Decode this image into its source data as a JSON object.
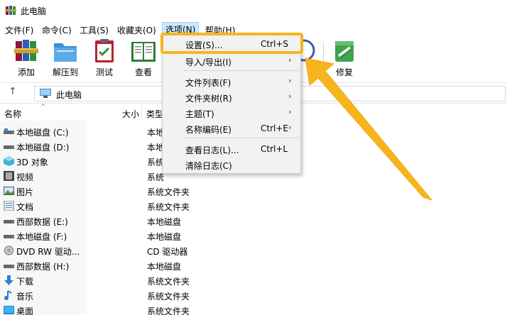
{
  "window": {
    "title": "此电脑"
  },
  "menubar": {
    "items": [
      {
        "label": "文件(F)"
      },
      {
        "label": "命令(C)"
      },
      {
        "label": "工具(S)"
      },
      {
        "label": "收藏夹(O)"
      },
      {
        "label": "选项(N)",
        "active": true
      },
      {
        "label": "帮助(H)"
      }
    ]
  },
  "toolbar": {
    "buttons": [
      {
        "label": "添加",
        "icon": "archive-books-icon"
      },
      {
        "label": "解压到",
        "icon": "folder-extract-icon"
      },
      {
        "label": "测试",
        "icon": "clipboard-check-icon"
      },
      {
        "label": "查看",
        "icon": "open-book-icon"
      },
      {
        "label": "息",
        "icon": "info-icon"
      },
      {
        "label": "修复",
        "icon": "first-aid-box-icon"
      }
    ]
  },
  "address": {
    "path": "此电脑",
    "up_icon": "up-arrow-icon"
  },
  "columns": {
    "name": "名称",
    "size": "大小",
    "type": "类型"
  },
  "files": [
    {
      "name": "本地磁盘 (C:)",
      "type": "本地",
      "icon": "drive-icon"
    },
    {
      "name": "本地磁盘 (D:)",
      "type": "本地",
      "icon": "drive-icon"
    },
    {
      "name": "3D 对象",
      "type": "系统",
      "icon": "cube-3d-icon"
    },
    {
      "name": "视频",
      "type": "系统",
      "icon": "video-icon"
    },
    {
      "name": "图片",
      "type": "系统文件夹",
      "icon": "picture-icon"
    },
    {
      "name": "文档",
      "type": "系统文件夹",
      "icon": "document-icon"
    },
    {
      "name": "西部数据 (E:)",
      "type": "本地磁盘",
      "icon": "drive-icon"
    },
    {
      "name": "本地磁盘 (F:)",
      "type": "本地磁盘",
      "icon": "drive-icon"
    },
    {
      "name": "DVD RW 驱动...",
      "type": "CD 驱动器",
      "icon": "dvd-drive-icon"
    },
    {
      "name": "西部数据 (H:)",
      "type": "本地磁盘",
      "icon": "drive-icon"
    },
    {
      "name": "下载",
      "type": "系统文件夹",
      "icon": "download-icon"
    },
    {
      "name": "音乐",
      "type": "系统文件夹",
      "icon": "music-icon"
    },
    {
      "name": "桌面",
      "type": "系统文件夹",
      "icon": "desktop-icon"
    }
  ],
  "dropdown": {
    "items": [
      {
        "label": "设置(S)...",
        "shortcut": "Ctrl+S",
        "highlighted": true
      },
      {
        "label": "导入/导出(I)",
        "shortcut": "",
        "submenu": true
      },
      {
        "separator": true
      },
      {
        "label": "文件列表(F)",
        "shortcut": "",
        "submenu": true
      },
      {
        "label": "文件夹树(R)",
        "shortcut": "",
        "submenu": true
      },
      {
        "label": "主题(T)",
        "shortcut": "",
        "submenu": true
      },
      {
        "label": "名称编码(E)",
        "shortcut": "Ctrl+E",
        "submenu": true
      },
      {
        "separator": true
      },
      {
        "label": "查看日志(L)...",
        "shortcut": "Ctrl+L"
      },
      {
        "label": "清除日志(C)",
        "shortcut": ""
      }
    ]
  },
  "colors": {
    "accent_highlight": "#f7b51d",
    "menu_active_bg": "#cce8ff",
    "menu_bg": "#f2f2f2"
  }
}
